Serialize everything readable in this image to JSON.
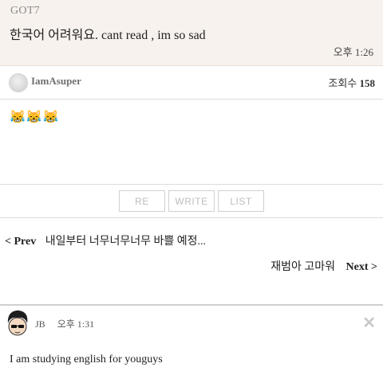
{
  "reply": {
    "author": "GOT7",
    "text": "한국어 어려워요. cant read , im so sad",
    "time": "오후 1:26"
  },
  "post": {
    "author": "IamAsuper",
    "views_label": "조회수",
    "views_count": "158",
    "body": "😹😹😹"
  },
  "buttons": {
    "re": "RE",
    "write": "WRITE",
    "list": "LIST"
  },
  "nav": {
    "prev_label": "< Prev",
    "prev_title": "내일부터 너무너무너무 바쁠 예정...",
    "next_title": "재범아 고마워",
    "next_label": "Next >"
  },
  "comment": {
    "author": "JB",
    "time": "오후 1:31",
    "text": "I am studying english for youguys",
    "close_icon": "close-icon"
  }
}
